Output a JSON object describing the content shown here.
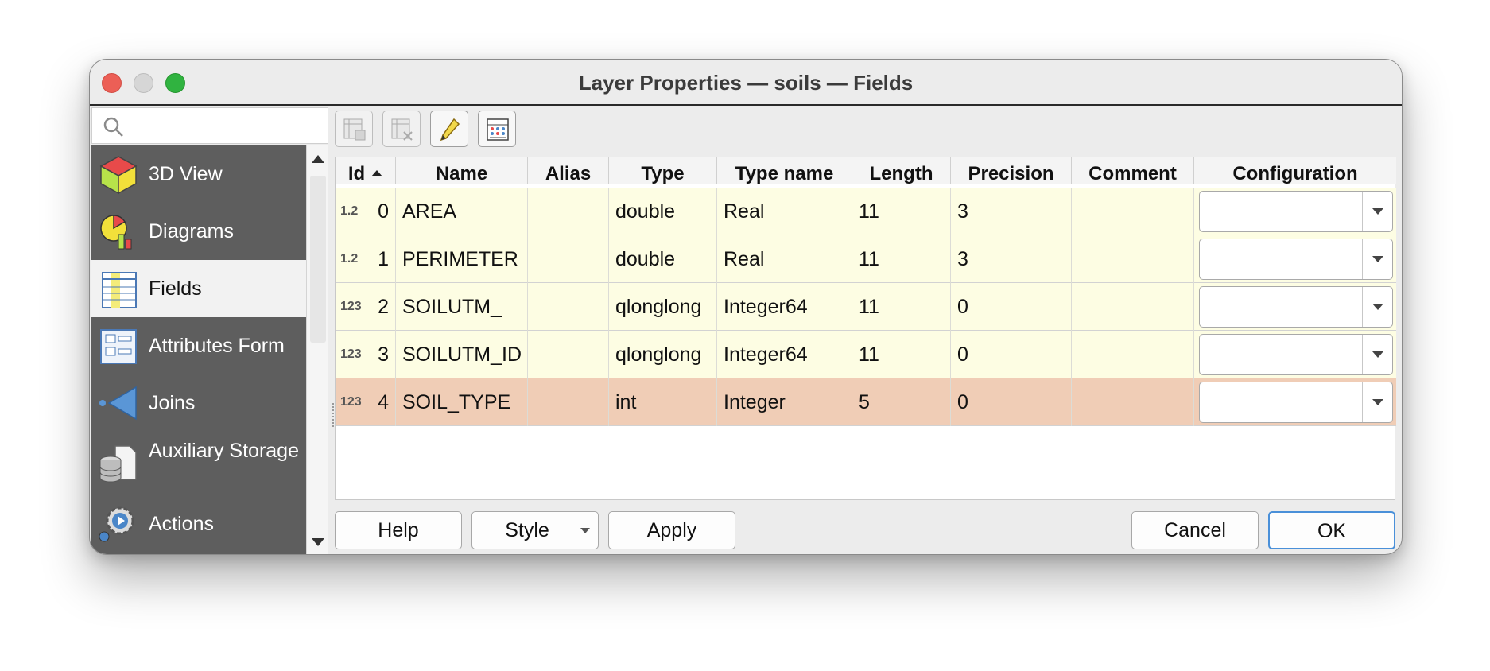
{
  "window": {
    "title": "Layer Properties — soils — Fields"
  },
  "search": {
    "placeholder": ""
  },
  "sidebar": {
    "items": [
      {
        "label": "3D View",
        "icon": "cube-icon"
      },
      {
        "label": "Diagrams",
        "icon": "diagram-icon"
      },
      {
        "label": "Fields",
        "icon": "fields-icon",
        "active": true
      },
      {
        "label": "Attributes Form",
        "icon": "form-icon"
      },
      {
        "label": "Joins",
        "icon": "joins-icon"
      },
      {
        "label": "Auxiliary Storage",
        "icon": "storage-icon"
      },
      {
        "label": "Actions",
        "icon": "actions-icon"
      }
    ]
  },
  "toolbar": {
    "buttons": [
      {
        "name": "new-field-icon",
        "enabled": false
      },
      {
        "name": "delete-field-icon",
        "enabled": false
      },
      {
        "name": "edit-pencil-icon",
        "enabled": true
      },
      {
        "name": "field-calculator-icon",
        "enabled": true
      }
    ]
  },
  "table": {
    "columns": [
      "Id",
      "Name",
      "Alias",
      "Type",
      "Type name",
      "Length",
      "Precision",
      "Comment",
      "Configuration"
    ],
    "sort_column": "Id",
    "rows": [
      {
        "type_icon": "1.2",
        "id": "0",
        "name": "AREA",
        "alias": "",
        "type": "double",
        "type_name": "Real",
        "length": "11",
        "precision": "3",
        "comment": ""
      },
      {
        "type_icon": "1.2",
        "id": "1",
        "name": "PERIMETER",
        "alias": "",
        "type": "double",
        "type_name": "Real",
        "length": "11",
        "precision": "3",
        "comment": ""
      },
      {
        "type_icon": "123",
        "id": "2",
        "name": "SOILUTM_",
        "alias": "",
        "type": "qlonglong",
        "type_name": "Integer64",
        "length": "11",
        "precision": "0",
        "comment": ""
      },
      {
        "type_icon": "123",
        "id": "3",
        "name": "SOILUTM_ID",
        "alias": "",
        "type": "qlonglong",
        "type_name": "Integer64",
        "length": "11",
        "precision": "0",
        "comment": ""
      },
      {
        "type_icon": "123",
        "id": "4",
        "name": "SOIL_TYPE",
        "alias": "",
        "type": "int",
        "type_name": "Integer",
        "length": "5",
        "precision": "0",
        "comment": ""
      }
    ],
    "selected_row": 4
  },
  "buttons": {
    "help": "Help",
    "style": "Style",
    "apply": "Apply",
    "cancel": "Cancel",
    "ok": "OK"
  },
  "colors": {
    "row_bg": "#fdfde3",
    "selected_row_bg": "#f0cdb6",
    "sidebar_bg": "#5e5e5e",
    "default_button_border": "#4a90d9"
  }
}
